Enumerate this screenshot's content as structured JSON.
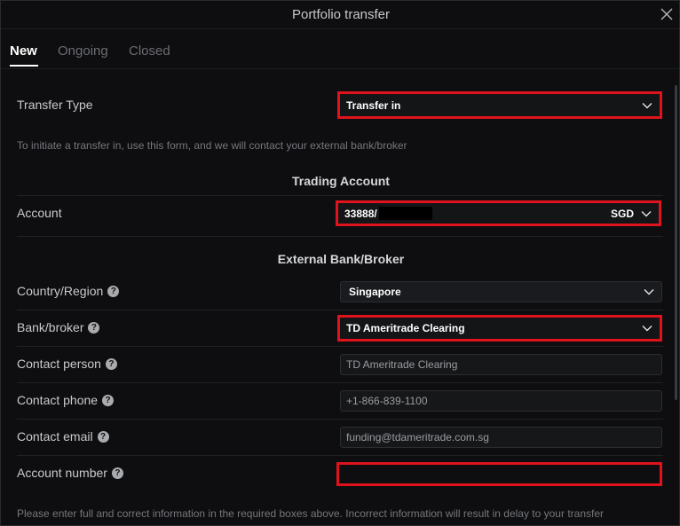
{
  "dialog": {
    "title": "Portfolio transfer"
  },
  "tabs": [
    {
      "label": "New",
      "active": true
    },
    {
      "label": "Ongoing",
      "active": false
    },
    {
      "label": "Closed",
      "active": false
    }
  ],
  "form": {
    "transfer_type": {
      "label": "Transfer Type",
      "value": "Transfer in"
    },
    "intro_hint": "To initiate a transfer in, use this form, and we will contact your external bank/broker",
    "trading_account_heading": "Trading Account",
    "account": {
      "label": "Account",
      "value_prefix": "33888/",
      "currency": "SGD"
    },
    "external_heading": "External Bank/Broker",
    "country": {
      "label": "Country/Region",
      "value": "Singapore"
    },
    "bank": {
      "label": "Bank/broker",
      "value": "TD Ameritrade Clearing"
    },
    "contact_person": {
      "label": "Contact person",
      "value": "TD Ameritrade Clearing"
    },
    "contact_phone": {
      "label": "Contact phone",
      "value": "+1-866-839-1100"
    },
    "contact_email": {
      "label": "Contact email",
      "value": "funding@tdameritrade.com.sg"
    },
    "account_number": {
      "label": "Account number",
      "value": ""
    },
    "footer_hint": "Please enter full and correct information in the required boxes above. Incorrect information will result in delay to your transfer"
  },
  "icons": {
    "help_glyph": "?"
  },
  "colors": {
    "highlight": "#e0131d",
    "background": "#0e0e10",
    "field": "#1a1b1e"
  }
}
